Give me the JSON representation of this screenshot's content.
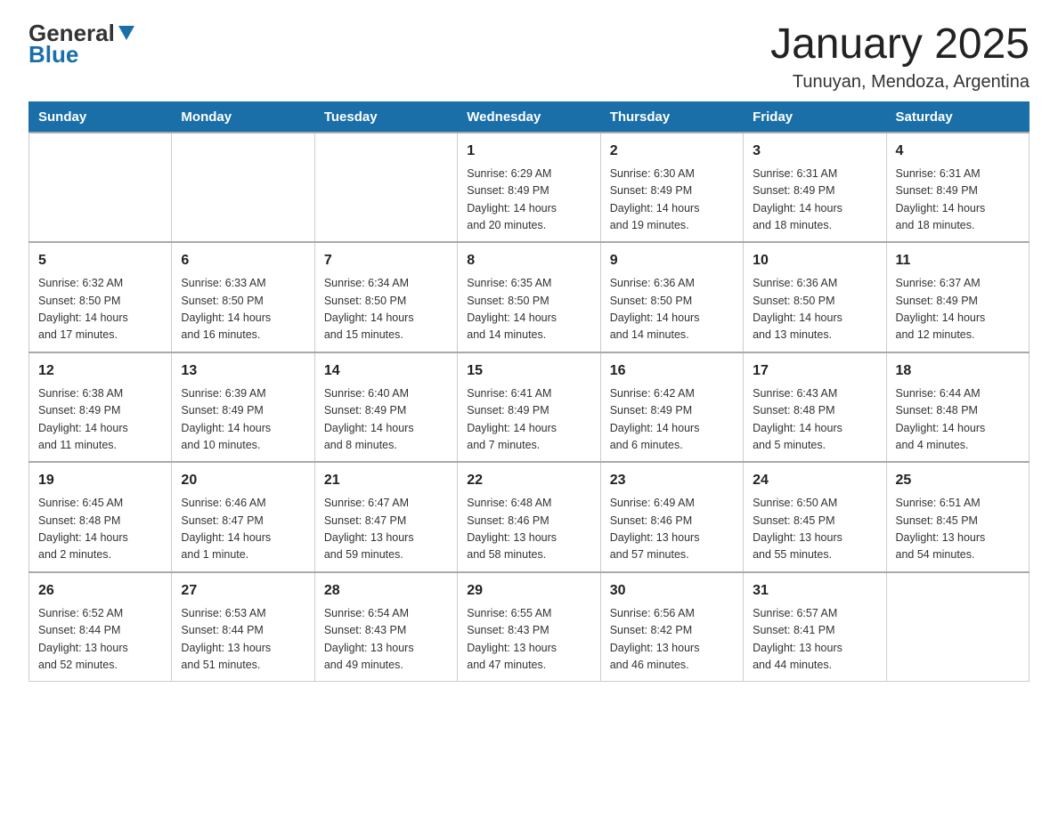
{
  "header": {
    "logo_general": "General",
    "logo_blue": "Blue",
    "main_title": "January 2025",
    "subtitle": "Tunuyan, Mendoza, Argentina"
  },
  "days_of_week": [
    "Sunday",
    "Monday",
    "Tuesday",
    "Wednesday",
    "Thursday",
    "Friday",
    "Saturday"
  ],
  "weeks": [
    [
      {
        "day": "",
        "info": ""
      },
      {
        "day": "",
        "info": ""
      },
      {
        "day": "",
        "info": ""
      },
      {
        "day": "1",
        "info": "Sunrise: 6:29 AM\nSunset: 8:49 PM\nDaylight: 14 hours\nand 20 minutes."
      },
      {
        "day": "2",
        "info": "Sunrise: 6:30 AM\nSunset: 8:49 PM\nDaylight: 14 hours\nand 19 minutes."
      },
      {
        "day": "3",
        "info": "Sunrise: 6:31 AM\nSunset: 8:49 PM\nDaylight: 14 hours\nand 18 minutes."
      },
      {
        "day": "4",
        "info": "Sunrise: 6:31 AM\nSunset: 8:49 PM\nDaylight: 14 hours\nand 18 minutes."
      }
    ],
    [
      {
        "day": "5",
        "info": "Sunrise: 6:32 AM\nSunset: 8:50 PM\nDaylight: 14 hours\nand 17 minutes."
      },
      {
        "day": "6",
        "info": "Sunrise: 6:33 AM\nSunset: 8:50 PM\nDaylight: 14 hours\nand 16 minutes."
      },
      {
        "day": "7",
        "info": "Sunrise: 6:34 AM\nSunset: 8:50 PM\nDaylight: 14 hours\nand 15 minutes."
      },
      {
        "day": "8",
        "info": "Sunrise: 6:35 AM\nSunset: 8:50 PM\nDaylight: 14 hours\nand 14 minutes."
      },
      {
        "day": "9",
        "info": "Sunrise: 6:36 AM\nSunset: 8:50 PM\nDaylight: 14 hours\nand 14 minutes."
      },
      {
        "day": "10",
        "info": "Sunrise: 6:36 AM\nSunset: 8:50 PM\nDaylight: 14 hours\nand 13 minutes."
      },
      {
        "day": "11",
        "info": "Sunrise: 6:37 AM\nSunset: 8:49 PM\nDaylight: 14 hours\nand 12 minutes."
      }
    ],
    [
      {
        "day": "12",
        "info": "Sunrise: 6:38 AM\nSunset: 8:49 PM\nDaylight: 14 hours\nand 11 minutes."
      },
      {
        "day": "13",
        "info": "Sunrise: 6:39 AM\nSunset: 8:49 PM\nDaylight: 14 hours\nand 10 minutes."
      },
      {
        "day": "14",
        "info": "Sunrise: 6:40 AM\nSunset: 8:49 PM\nDaylight: 14 hours\nand 8 minutes."
      },
      {
        "day": "15",
        "info": "Sunrise: 6:41 AM\nSunset: 8:49 PM\nDaylight: 14 hours\nand 7 minutes."
      },
      {
        "day": "16",
        "info": "Sunrise: 6:42 AM\nSunset: 8:49 PM\nDaylight: 14 hours\nand 6 minutes."
      },
      {
        "day": "17",
        "info": "Sunrise: 6:43 AM\nSunset: 8:48 PM\nDaylight: 14 hours\nand 5 minutes."
      },
      {
        "day": "18",
        "info": "Sunrise: 6:44 AM\nSunset: 8:48 PM\nDaylight: 14 hours\nand 4 minutes."
      }
    ],
    [
      {
        "day": "19",
        "info": "Sunrise: 6:45 AM\nSunset: 8:48 PM\nDaylight: 14 hours\nand 2 minutes."
      },
      {
        "day": "20",
        "info": "Sunrise: 6:46 AM\nSunset: 8:47 PM\nDaylight: 14 hours\nand 1 minute."
      },
      {
        "day": "21",
        "info": "Sunrise: 6:47 AM\nSunset: 8:47 PM\nDaylight: 13 hours\nand 59 minutes."
      },
      {
        "day": "22",
        "info": "Sunrise: 6:48 AM\nSunset: 8:46 PM\nDaylight: 13 hours\nand 58 minutes."
      },
      {
        "day": "23",
        "info": "Sunrise: 6:49 AM\nSunset: 8:46 PM\nDaylight: 13 hours\nand 57 minutes."
      },
      {
        "day": "24",
        "info": "Sunrise: 6:50 AM\nSunset: 8:45 PM\nDaylight: 13 hours\nand 55 minutes."
      },
      {
        "day": "25",
        "info": "Sunrise: 6:51 AM\nSunset: 8:45 PM\nDaylight: 13 hours\nand 54 minutes."
      }
    ],
    [
      {
        "day": "26",
        "info": "Sunrise: 6:52 AM\nSunset: 8:44 PM\nDaylight: 13 hours\nand 52 minutes."
      },
      {
        "day": "27",
        "info": "Sunrise: 6:53 AM\nSunset: 8:44 PM\nDaylight: 13 hours\nand 51 minutes."
      },
      {
        "day": "28",
        "info": "Sunrise: 6:54 AM\nSunset: 8:43 PM\nDaylight: 13 hours\nand 49 minutes."
      },
      {
        "day": "29",
        "info": "Sunrise: 6:55 AM\nSunset: 8:43 PM\nDaylight: 13 hours\nand 47 minutes."
      },
      {
        "day": "30",
        "info": "Sunrise: 6:56 AM\nSunset: 8:42 PM\nDaylight: 13 hours\nand 46 minutes."
      },
      {
        "day": "31",
        "info": "Sunrise: 6:57 AM\nSunset: 8:41 PM\nDaylight: 13 hours\nand 44 minutes."
      },
      {
        "day": "",
        "info": ""
      }
    ]
  ]
}
